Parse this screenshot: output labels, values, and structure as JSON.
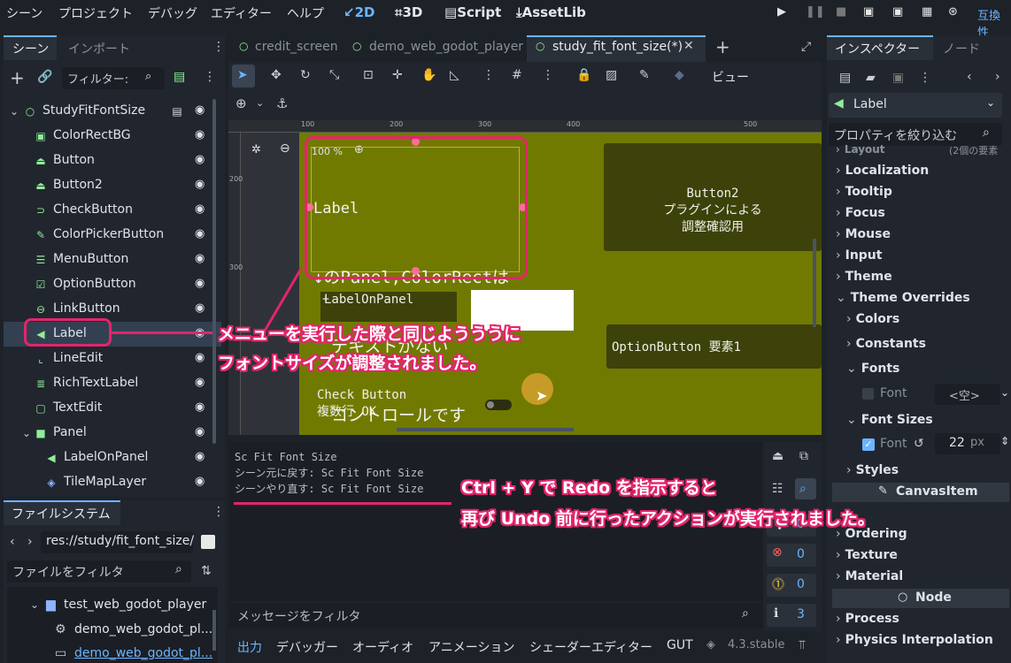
{
  "menubar": {
    "items": [
      "シーン",
      "プロジェクト",
      "デバッグ",
      "エディター",
      "ヘルプ"
    ],
    "workspaces": [
      "2D",
      "3D",
      "Script",
      "AssetLib"
    ],
    "compat": "互換性"
  },
  "left_dock": {
    "tabs": [
      "シーン",
      "インポート"
    ],
    "filter_placeholder": "フィルター:",
    "tree": [
      {
        "label": "StudyFitFontSize",
        "icon": "○"
      },
      {
        "label": "ColorRectBG",
        "icon": "▣"
      },
      {
        "label": "Button",
        "icon": "⏏"
      },
      {
        "label": "Button2",
        "icon": "⏏"
      },
      {
        "label": "CheckButton",
        "icon": "⊃"
      },
      {
        "label": "ColorPickerButton",
        "icon": "✎"
      },
      {
        "label": "MenuButton",
        "icon": "☰"
      },
      {
        "label": "OptionButton",
        "icon": "☑"
      },
      {
        "label": "LinkButton",
        "icon": "⊖"
      },
      {
        "label": "Label",
        "icon": "◀"
      },
      {
        "label": "LineEdit",
        "icon": "⌞"
      },
      {
        "label": "RichTextLabel",
        "icon": "≣"
      },
      {
        "label": "TextEdit",
        "icon": "▢"
      },
      {
        "label": "Panel",
        "icon": "■"
      },
      {
        "label": "LabelOnPanel",
        "icon": "◀"
      },
      {
        "label": "TileMapLayer",
        "icon": "◈"
      }
    ]
  },
  "filesystem": {
    "title": "ファイルシステム",
    "path": "res://study/fit_font_size/",
    "filter_placeholder": "ファイルをフィルタ",
    "items": [
      "test_web_godot_player",
      "demo_web_godot_pl...",
      "demo_web_godot_pl..."
    ]
  },
  "editor_tabs": [
    "credit_screen",
    "demo_web_godot_player",
    "study_fit_font_size(*)"
  ],
  "toolbar": {
    "view_label": "ビュー"
  },
  "viewport": {
    "zoom": "100 %",
    "ruler_h": [
      "100",
      "200",
      "300",
      "400",
      "500"
    ],
    "ruler_v": [
      "200",
      "300"
    ],
    "label_lines": [
      "Label",
      "↓のPanel,ColorRectは",
      "テキストがない",
      "コントロールです"
    ],
    "button2_lines": [
      "Button2",
      "プラグインによる",
      "調整確認用"
    ],
    "label_on_panel": "LabelOnPanel",
    "option_button": "OptionButton 要素1",
    "check_button_lines": [
      "Check Button",
      "複数行 OK"
    ]
  },
  "output": {
    "lines": [
      "Sc Fit Font Size",
      "シーン元に戻す: Sc Fit Font Size",
      "シーンやり直す: Sc Fit Font Size"
    ],
    "filter_placeholder": "メッセージをフィルタ",
    "counts": [
      "0",
      "0",
      "0",
      "3"
    ]
  },
  "bottom_tabs": [
    "出力",
    "デバッガー",
    "オーディオ",
    "アニメーション",
    "シェーダーエディター",
    "GUT"
  ],
  "version": "4.3.stable",
  "inspector": {
    "tabs": [
      "インスペクター",
      "ノード"
    ],
    "node_type": "Label",
    "filter_placeholder": "プロパティを絞り込む",
    "layout_hint": "(2個の要素",
    "sections": [
      "Layout",
      "Localization",
      "Tooltip",
      "Focus",
      "Mouse",
      "Input",
      "Theme",
      "Theme Overrides"
    ],
    "subsections": [
      "Colors",
      "Constants",
      "Fonts"
    ],
    "font_label": "Font",
    "font_value": "<空>",
    "font_sizes_label": "Font Sizes",
    "font_size_value": "22",
    "font_size_unit": "px",
    "styles_label": "Styles",
    "canvas_item": "CanvasItem",
    "canvas_sections": [
      "Ordering",
      "Texture",
      "Material"
    ],
    "node_header": "Node",
    "node_sections": [
      "Process",
      "Physics Interpolation"
    ]
  },
  "annotations": {
    "callout1": [
      "メニューを実行した際と同じようううに",
      "フォントサイズが調整されました。"
    ],
    "callout2": [
      "Ctrl + Y で Redo を指示すると",
      "再び Undo 前に行ったアクションが実行されました。"
    ]
  },
  "colors": {
    "accent": "#e3256b",
    "viewport_bg": "#717a00",
    "selection": "#d6a441"
  }
}
